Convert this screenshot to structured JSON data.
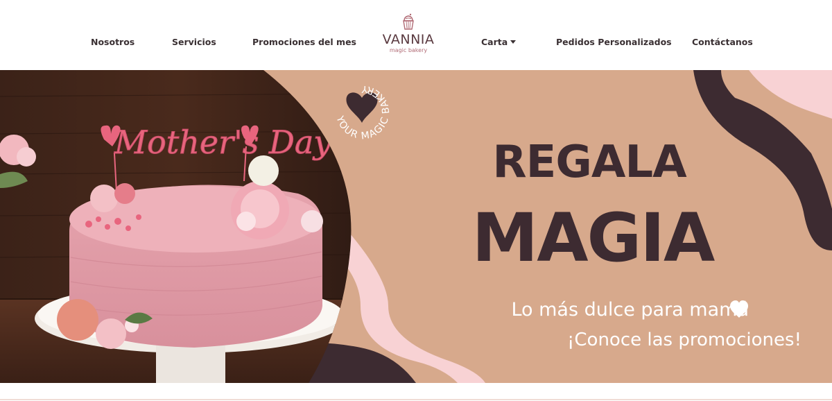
{
  "nav": {
    "items": [
      {
        "label": "Nosotros"
      },
      {
        "label": "Servicios"
      },
      {
        "label": "Promociones del mes"
      },
      {
        "label": "Carta"
      },
      {
        "label": "Pedidos Personalizados"
      },
      {
        "label": "Contáctanos"
      }
    ],
    "logo": {
      "brand": "VANNIA",
      "tagline": "magic bakery"
    }
  },
  "hero": {
    "badge_text": "YOUR MAGIC BAKERY",
    "cake_topper": "Mother's Day",
    "headline_line1": "REGALA",
    "headline_line2": "MAGIA",
    "subtitle": "Lo más dulce para mamá",
    "cta": "¡Conoce las promociones!"
  },
  "colors": {
    "peach": "#d7a98c",
    "plum": "#3d2b31",
    "pink": "#f8d2d4",
    "white": "#ffffff"
  }
}
